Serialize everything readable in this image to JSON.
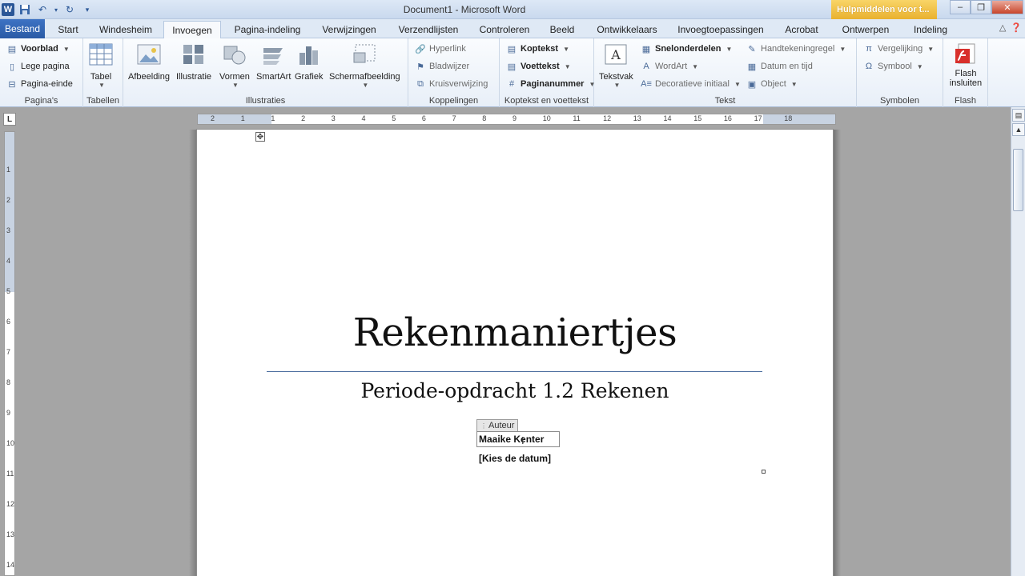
{
  "titlebar": {
    "title": "Document1  -  Microsoft Word",
    "context_tab": "Hulpmiddelen voor t..."
  },
  "tabs": {
    "file": "Bestand",
    "items": [
      "Start",
      "Windesheim",
      "Invoegen",
      "Pagina-indeling",
      "Verwijzingen",
      "Verzendlijsten",
      "Controleren",
      "Beeld",
      "Ontwikkelaars",
      "Invoegtoepassingen",
      "Acrobat",
      "Ontwerpen",
      "Indeling"
    ],
    "active": "Invoegen"
  },
  "ribbon": {
    "paginas": {
      "label": "Pagina's",
      "voorblad": "Voorblad",
      "lege_pagina": "Lege pagina",
      "pagina_einde": "Pagina-einde"
    },
    "tabellen": {
      "label": "Tabellen",
      "tabel": "Tabel"
    },
    "illustraties": {
      "label": "Illustraties",
      "afbeelding": "Afbeelding",
      "illustratie": "Illustratie",
      "vormen": "Vormen",
      "smartart": "SmartArt",
      "grafiek": "Grafiek",
      "schermafbeelding": "Schermafbeelding"
    },
    "koppelingen": {
      "label": "Koppelingen",
      "hyperlink": "Hyperlink",
      "bladwijzer": "Bladwijzer",
      "kruisverwijzing": "Kruisverwijzing"
    },
    "koptekst": {
      "label": "Koptekst en voettekst",
      "koptekst": "Koptekst",
      "voettekst": "Voettekst",
      "paginanummer": "Paginanummer"
    },
    "tekst": {
      "label": "Tekst",
      "tekstvak": "Tekstvak",
      "snelonderdelen": "Snelonderdelen",
      "wordart": "WordArt",
      "decoratieve": "Decoratieve initiaal",
      "handtekeningregel": "Handtekeningregel",
      "datum": "Datum en tijd",
      "object": "Object"
    },
    "symbolen": {
      "label": "Symbolen",
      "vergelijking": "Vergelijking",
      "symbool": "Symbool"
    },
    "flash": {
      "label": "Flash",
      "button": "Flash insluiten"
    }
  },
  "ruler": {
    "h_ticks": [
      "2",
      "1",
      "1",
      "2",
      "3",
      "4",
      "5",
      "6",
      "7",
      "8",
      "9",
      "10",
      "11",
      "12",
      "13",
      "14",
      "15",
      "16",
      "17",
      "18"
    ],
    "v_ticks": [
      "1",
      "2",
      "3",
      "4",
      "5",
      "6",
      "7",
      "8",
      "9",
      "10",
      "11",
      "12",
      "13",
      "14"
    ]
  },
  "document": {
    "title": "Rekenmaniertjes",
    "subtitle": "Periode-opdracht 1.2 Rekenen",
    "author_tag": "Auteur",
    "author": "Maaike Kenter",
    "date_placeholder": "[Kies de datum]"
  },
  "icons": {
    "quick_access": [
      "word-logo-icon",
      "save-icon",
      "undo-icon",
      "redo-icon",
      "customize-icon"
    ],
    "window": [
      "minimize-icon",
      "restore-icon",
      "close-icon"
    ]
  }
}
